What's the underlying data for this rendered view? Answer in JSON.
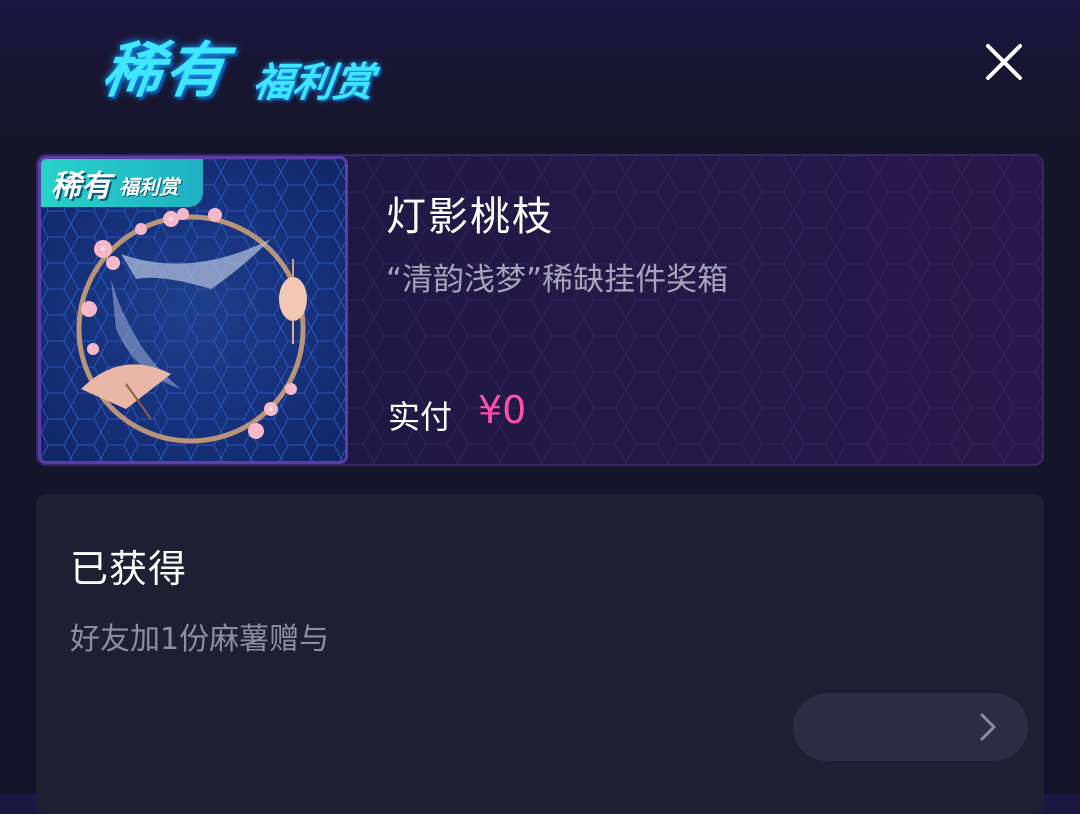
{
  "header": {
    "logo_big": "稀有",
    "logo_small": "福利赏",
    "close_icon": "close-icon"
  },
  "reward_card": {
    "badge_big": "稀有",
    "badge_small": "福利赏",
    "item_name": "灯影桃枝",
    "item_desc": "“清韵浅梦”稀缺挂件奖箱",
    "pay_label": "实付",
    "pay_value": "¥0",
    "accent_color": "#ff4fa8"
  },
  "status_panel": {
    "title": "已获得",
    "subtitle": "好友加1份麻薯赠与",
    "action_icon": "chevron-right-icon"
  }
}
